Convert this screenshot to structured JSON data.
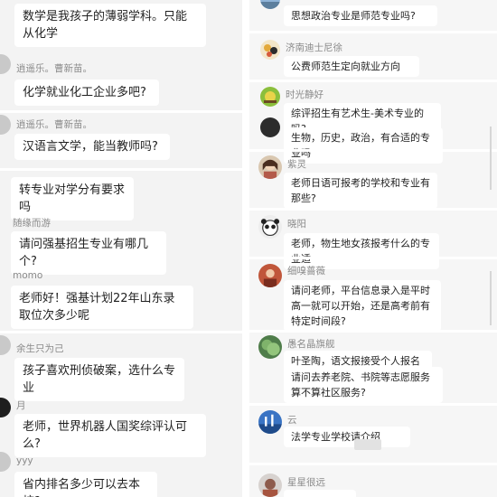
{
  "left": {
    "items": [
      {
        "name": "",
        "text": "数学是我孩子的薄弱学科。只能从化学"
      },
      {
        "name": "逍遥乐。曹新苗。",
        "text": "化学就业化工企业多吧?"
      },
      {
        "name": "逍遥乐。曹新苗。",
        "text": "汉语言文学，能当教师吗?"
      },
      {
        "name": "",
        "text": "转专业对学分有要求吗"
      },
      {
        "name": "随缘而游",
        "text": "请问强基招生专业有哪几个?"
      },
      {
        "name": "momo",
        "text": "老师好！强基计划22年山东录取位次多少呢"
      },
      {
        "name": "余生只为己",
        "text": "孩子喜欢刑侦破案，选什么专业"
      },
      {
        "name": "月",
        "text": "老师，世界机器人国奖综评认可么?"
      },
      {
        "name": "yyy",
        "text": "省内排名多少可以去本校?"
      }
    ]
  },
  "right": {
    "items": [
      {
        "name": "",
        "text": "思想政治专业是师范专业吗?"
      },
      {
        "name": "济南迪士尼徐",
        "text": "公费师范生定向就业方向"
      },
      {
        "name": "时光静好",
        "text": "综评招生有艺术生-美术专业的吗?"
      },
      {
        "name": "",
        "text": "生物，历史，政治，有合适的专业吗"
      },
      {
        "name": "紫灵",
        "text": "老师日语可报考的学校和专业有那些?"
      },
      {
        "name": "晓阳",
        "text": "老师，物生地女孩报考什么的专业适"
      },
      {
        "name": "细嗅蔷薇",
        "text": "请问老师，平台信息录入是平时高一就可以开始，还是高考前有特定时间段?"
      },
      {
        "name": "愚名晶旗舰",
        "text": "叶圣陶，语文报接受个人报名嘛?"
      },
      {
        "name": "",
        "text": "请问去养老院、书院等志愿服务算不算社区服务?"
      },
      {
        "name": "云",
        "text": "法学专业学校请介绍"
      },
      {
        "name": "星星很远",
        "text": ""
      }
    ]
  },
  "colors": {
    "left_bg": "#f3f3f3",
    "right_bg": "#f6f6f6",
    "bubble": "#ffffff",
    "name_text": "#8a8a8a",
    "message_text": "#1f1f1f"
  },
  "avatars": [
    "avatar-sky-icon",
    "avatar-cartoon-icon",
    "avatar-green-icon",
    "avatar-girl-icon",
    "avatar-panda-icon",
    "avatar-red-icon",
    "avatar-plant-icon",
    "avatar-bluesky-icon",
    "avatar-dark-icon"
  ]
}
